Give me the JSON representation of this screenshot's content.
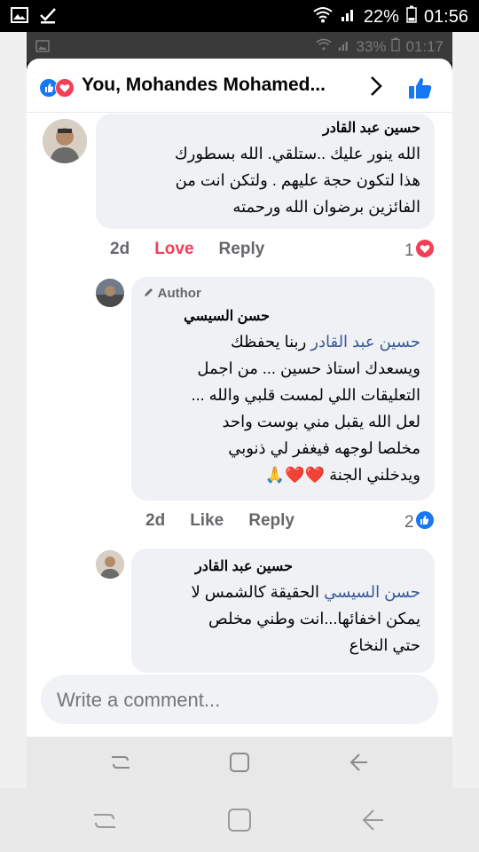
{
  "status_bar": {
    "battery": "22%",
    "time": "01:56"
  },
  "inner_status_bar": {
    "battery": "33%",
    "time": "01:17"
  },
  "header": {
    "title": "You, Mohandes Mohamed..."
  },
  "comments": [
    {
      "author": "حسين عبد القادر",
      "lines": [
        "الله ينور عليك ..ستلقي. الله بسطورك",
        "هذا لتكون حجة عليهم . ولتكن انت من",
        "الفائزين برضوان الله ورحمته"
      ],
      "time": "2d",
      "reaction_label": "Love",
      "reply_label": "Reply",
      "reaction_count": "1"
    },
    {
      "badge": "Author",
      "author": "حسن السيسي",
      "mention": "حسين عبد القادر",
      "first_line_rest": " ربنا يحفظك",
      "lines": [
        "ويسعدك استاذ حسين ... من اجمل",
        "التعليقات اللي لمست قلبي والله ...",
        "لعل الله يقبل مني بوست واحد",
        "مخلصا لوجهه فيغفر لي ذنوبي",
        "ويدخلني الجنة ❤️❤️🙏"
      ],
      "time": "2d",
      "reaction_label": "Like",
      "reply_label": "Reply",
      "reaction_count": "2"
    },
    {
      "author": "حسين عبد القادر",
      "mention": "حسن السيسي",
      "first_line_rest": " الحقيقة كالشمس لا",
      "lines": [
        "يمكن اخفائها...انت وطني مخلص",
        "حتي النخاع"
      ]
    }
  ],
  "composer": {
    "placeholder": "Write a comment..."
  },
  "icons": [
    "image-icon",
    "check-icon",
    "wifi-icon",
    "signal-icon",
    "battery-icon",
    "like-reaction-icon",
    "love-reaction-icon",
    "chevron-right-icon",
    "thumbs-up-icon",
    "pencil-icon",
    "recent-apps-icon",
    "home-icon",
    "back-icon"
  ],
  "colors": {
    "facebook_blue": "#1877f2",
    "love_red": "#f33e58",
    "mention": "#385898",
    "bubble": "#eff1f5"
  }
}
